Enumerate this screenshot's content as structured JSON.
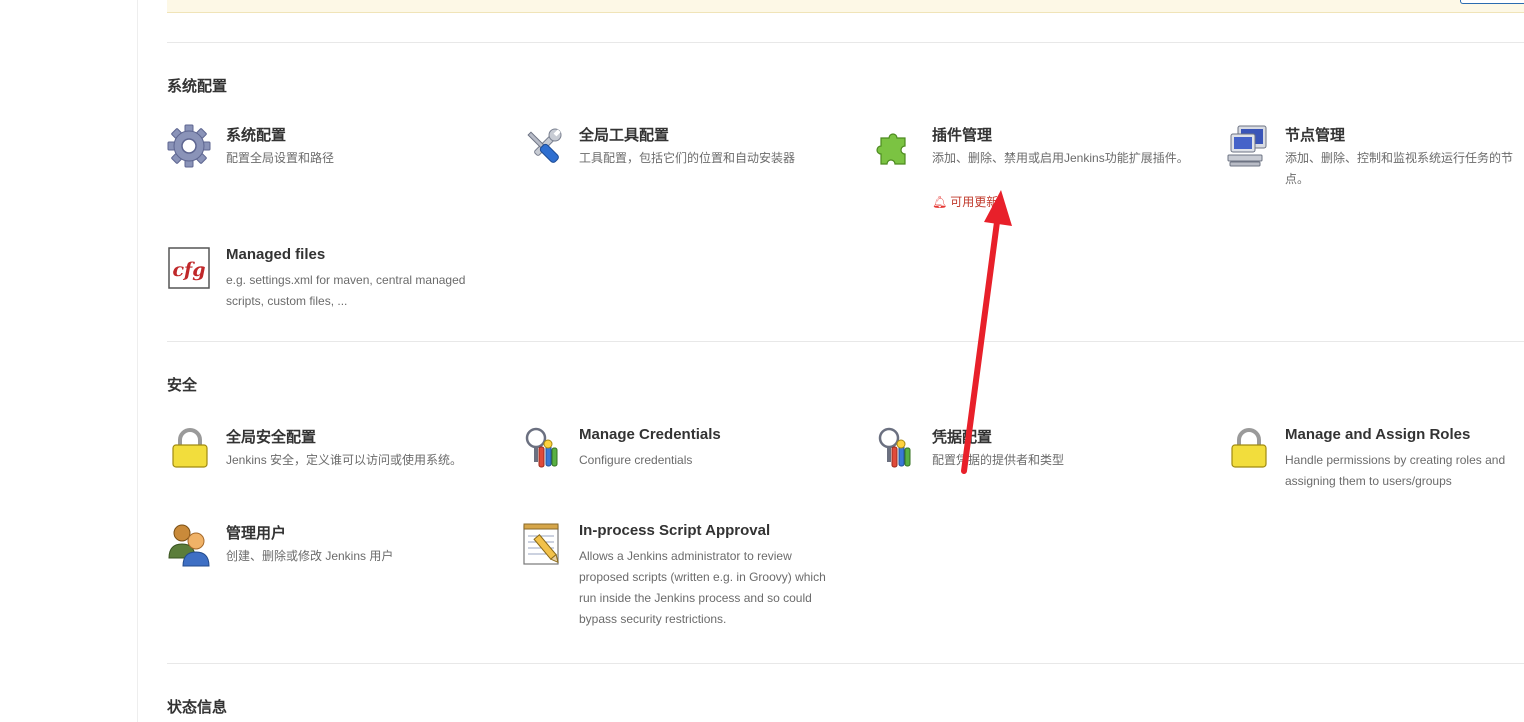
{
  "sections": {
    "system": {
      "title": "系统配置",
      "items": [
        {
          "name": "系统配置",
          "desc": "配置全局设置和路径",
          "icon": "gear-icon"
        },
        {
          "name": "全局工具配置",
          "desc": "工具配置，包括它们的位置和自动安装器",
          "icon": "wrench-screwdriver-icon"
        },
        {
          "name": "插件管理",
          "desc": "添加、删除、禁用或启用Jenkins功能扩展插件。",
          "update": "可用更新",
          "icon": "puzzle-piece-icon"
        },
        {
          "name": "节点管理",
          "desc": "添加、删除、控制和监视系统运行任务的节点。",
          "icon": "computer-icon"
        },
        {
          "name": "Managed files",
          "desc": "e.g. settings.xml for maven, central managed scripts, custom files, ...",
          "icon": "cfg-icon"
        }
      ]
    },
    "security": {
      "title": "安全",
      "items": [
        {
          "name": "全局安全配置",
          "desc": "Jenkins 安全，定义谁可以访问或使用系统。",
          "icon": "lock-icon"
        },
        {
          "name": "Manage Credentials",
          "desc": "Configure credentials",
          "icon": "keys-icon"
        },
        {
          "name": "凭据配置",
          "desc": "配置凭据的提供者和类型",
          "icon": "keys-icon"
        },
        {
          "name": "Manage and Assign Roles",
          "desc": "Handle permissions by creating roles and assigning them to users/groups",
          "icon": "lock-icon"
        },
        {
          "name": "管理用户",
          "desc": "创建、删除或修改 Jenkins 用户",
          "icon": "users-icon"
        },
        {
          "name": "In-process Script Approval",
          "desc": "Allows a Jenkins administrator to review proposed scripts (written e.g. in Groovy) which run inside the Jenkins process and so could bypass security restrictions.",
          "icon": "notepad-pencil-icon"
        }
      ]
    },
    "status": {
      "title": "状态信息"
    }
  },
  "colors": {
    "annotation_arrow": "#e8202a",
    "update_badge": "#c0392b",
    "notice_background": "#fdf8e6"
  }
}
